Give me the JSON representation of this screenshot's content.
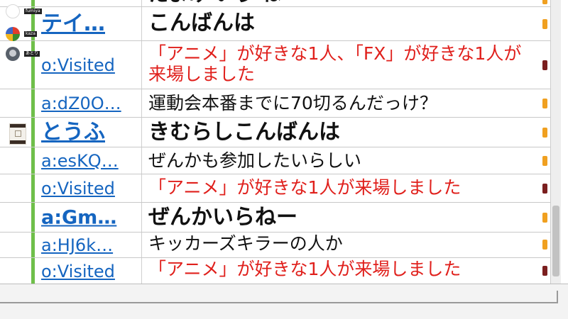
{
  "viewers": [
    {
      "name": "fumiya"
    },
    {
      "name": "kaza"
    },
    {
      "name": "あとり"
    }
  ],
  "rows": [
    {
      "user": "",
      "message": "たまみ いう ね",
      "user_style": "partial",
      "msg_style": "normal",
      "mark": "orange"
    },
    {
      "user": "テイ…",
      "message": "こんばんは",
      "user_style": "bold",
      "msg_style": "bold",
      "mark": "orange"
    },
    {
      "user": "o:Visited",
      "message": "「アニメ」が好きな1人、「FX」が好きな1人が来場しました",
      "user_style": "normal",
      "msg_style": "red",
      "mark": "dark"
    },
    {
      "user": "a:dZ0O…",
      "message": "運動会本番までに70切るんだっけ？",
      "user_style": "normal",
      "msg_style": "normal",
      "mark": "orange"
    },
    {
      "user": "とうふ",
      "message": "きむらしこんばんは",
      "user_style": "bold",
      "msg_style": "bold",
      "mark": "orange"
    },
    {
      "user": "a:esKQ…",
      "message": "ぜんかも参加したいらしい",
      "user_style": "normal",
      "msg_style": "normal",
      "mark": "orange"
    },
    {
      "user": "o:Visited",
      "message": "「アニメ」が好きな1人が来場しました",
      "user_style": "normal",
      "msg_style": "red",
      "mark": "dark"
    },
    {
      "user": "a:Gm…",
      "message": "ぜんかいらねー",
      "user_style": "bold",
      "msg_style": "bold",
      "mark": "orange"
    },
    {
      "user": "a:HJ6k…",
      "message": "キッカーズキラーの人か",
      "user_style": "normal",
      "msg_style": "normal",
      "mark": "orange"
    },
    {
      "user": "o:Visited",
      "message": "「アニメ」が好きな1人が来場しました",
      "user_style": "normal",
      "msg_style": "red",
      "mark": "dark"
    }
  ],
  "colors": {
    "link": "#1565c0",
    "system_red": "#e0201c",
    "accent_green": "#6fbf4a",
    "mark_orange": "#f0a020",
    "mark_dark": "#7b1f1f"
  }
}
